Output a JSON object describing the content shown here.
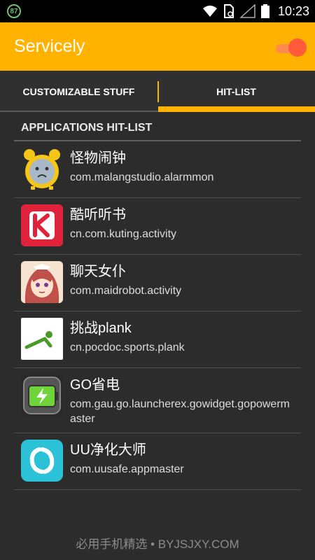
{
  "status_bar": {
    "badge": "87",
    "time": "10:23"
  },
  "app_bar": {
    "title": "Servicely",
    "toggle_on": true
  },
  "tabs": [
    {
      "label": "CUSTOMIZABLE STUFF",
      "selected": false
    },
    {
      "label": "HIT-LIST",
      "selected": true
    }
  ],
  "section": {
    "title": "APPLICATIONS HIT-LIST"
  },
  "apps": [
    {
      "name": "怪物闹钟",
      "package": "com.malangstudio.alarmmon",
      "icon": "alarm-clock-icon"
    },
    {
      "name": "酷听听书",
      "package": "cn.com.kuting.activity",
      "icon": "k-logo-icon"
    },
    {
      "name": "聊天女仆",
      "package": "com.maidrobot.activity",
      "icon": "maid-character-icon"
    },
    {
      "name": "挑战plank",
      "package": "cn.pocdoc.sports.plank",
      "icon": "plank-figure-icon"
    },
    {
      "name": "GO省电",
      "package": "com.gau.go.launcherex.gowidget.gopowermaster",
      "icon": "battery-icon"
    },
    {
      "name": "UU净化大师",
      "package": "com.uusafe.appmaster",
      "icon": "uu-logo-icon"
    }
  ],
  "footer": {
    "watermark": "必用手机精选 • BYJSJXY.COM"
  },
  "colors": {
    "accent": "#ffb300",
    "toggle": "#ff5a3a",
    "background": "#2c2c2c"
  }
}
